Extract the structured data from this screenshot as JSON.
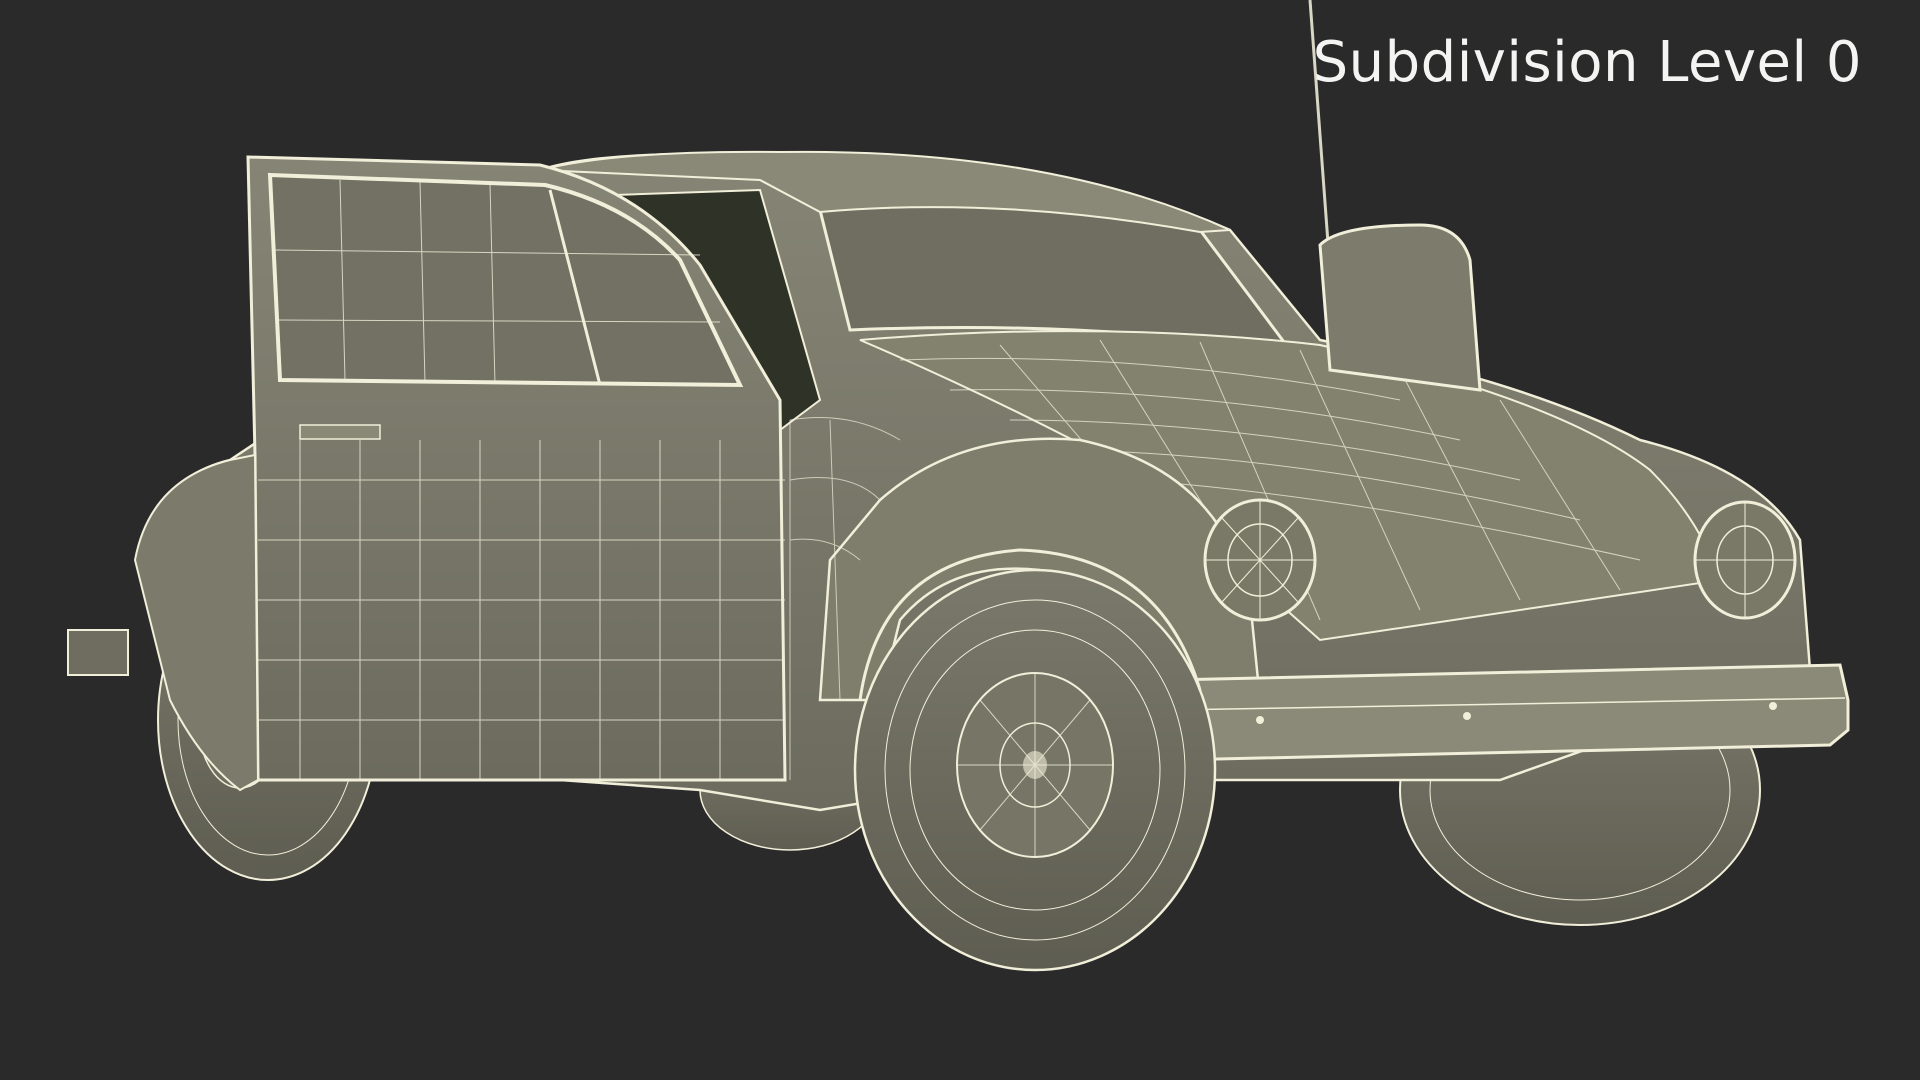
{
  "viewport": {
    "label": "Subdivision Level 0",
    "background_color": "#2a2a2a",
    "label_color": "#f4f4f2"
  },
  "model": {
    "subject": "car-wireframe",
    "body_color": "#7c7b6d",
    "body_shadow_color": "#5d5c50",
    "wire_color": "#f1efd9",
    "interior_color": "#2f3226"
  }
}
